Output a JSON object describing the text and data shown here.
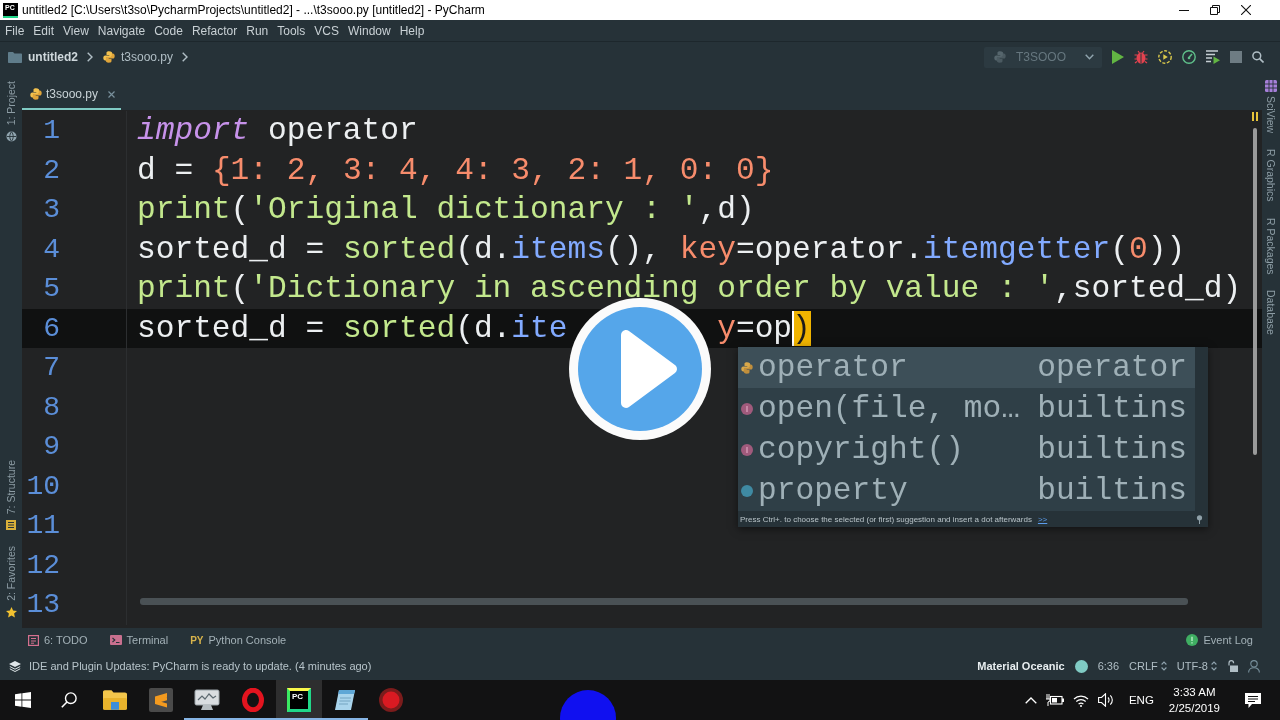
{
  "window": {
    "icon_label": "PC",
    "title": "untitled2 [C:\\Users\\t3so\\PycharmProjects\\untitled2] - ...\\t3sooo.py [untitled2] - PyCharm"
  },
  "menu": [
    "File",
    "Edit",
    "View",
    "Navigate",
    "Code",
    "Refactor",
    "Run",
    "Tools",
    "VCS",
    "Window",
    "Help"
  ],
  "breadcrumbs": [
    {
      "kind": "folder",
      "label": "untitled2"
    },
    {
      "kind": "python_file",
      "label": "t3sooo.py"
    }
  ],
  "run_config": {
    "label": "T3SOOO"
  },
  "left_tools": [
    {
      "kind": "project",
      "label": "1: Project"
    },
    {
      "kind": "structure",
      "label": "7: Structure"
    },
    {
      "kind": "favorites",
      "label": "2: Favorites"
    }
  ],
  "editor_tabs": [
    {
      "label": "t3sooo.py",
      "selected": true
    }
  ],
  "editor": {
    "lines": [
      {
        "number": "1",
        "current": false,
        "tokens": [
          {
            "text": "import",
            "kind": "keyword"
          },
          {
            "text": " operator",
            "kind": "plain"
          }
        ]
      },
      {
        "number": "2",
        "current": false,
        "tokens": [
          {
            "text": "d = ",
            "kind": "plain"
          },
          {
            "text": "{1: 2, 3: 4, 4: 3, 2: 1, 0: 0}",
            "kind": "literal"
          }
        ]
      },
      {
        "number": "3",
        "current": false,
        "tokens": [
          {
            "text": "print",
            "kind": "builtin"
          },
          {
            "text": "(",
            "kind": "plain"
          },
          {
            "text": "'Original dictionary : '",
            "kind": "string"
          },
          {
            "text": ",d)",
            "kind": "plain"
          }
        ]
      },
      {
        "number": "4",
        "current": false,
        "tokens": [
          {
            "text": "sorted_d = ",
            "kind": "plain"
          },
          {
            "text": "sorted",
            "kind": "builtin"
          },
          {
            "text": "(d.",
            "kind": "plain"
          },
          {
            "text": "items",
            "kind": "method"
          },
          {
            "text": "(), ",
            "kind": "plain"
          },
          {
            "text": "key",
            "kind": "param"
          },
          {
            "text": "=operator.",
            "kind": "plain"
          },
          {
            "text": "itemgetter",
            "kind": "method"
          },
          {
            "text": "(",
            "kind": "plain"
          },
          {
            "text": "0",
            "kind": "literal"
          },
          {
            "text": "))",
            "kind": "plain"
          }
        ]
      },
      {
        "number": "5",
        "current": false,
        "tokens": [
          {
            "text": "print",
            "kind": "builtin"
          },
          {
            "text": "(",
            "kind": "plain"
          },
          {
            "text": "'Dictionary in ascending order by value : '",
            "kind": "string"
          },
          {
            "text": ",sorted_d)",
            "kind": "plain"
          }
        ]
      },
      {
        "number": "6",
        "current": true,
        "tokens": [
          {
            "text": "sorted_d = ",
            "kind": "plain"
          },
          {
            "text": "sorted",
            "kind": "builtin"
          },
          {
            "text": "(d.",
            "kind": "plain"
          },
          {
            "text": "ite",
            "kind": "method"
          },
          {
            "kind": "covered"
          },
          {
            "text": "y",
            "kind": "param"
          },
          {
            "text": "=op",
            "kind": "plain"
          },
          {
            "text": ")",
            "kind": "brace_match",
            "caret": true
          }
        ]
      },
      {
        "number": "7",
        "current": false
      },
      {
        "number": "8",
        "current": false
      },
      {
        "number": "9",
        "current": false
      },
      {
        "number": "10",
        "current": false
      },
      {
        "number": "11",
        "current": false
      },
      {
        "number": "12",
        "current": false
      },
      {
        "number": "13",
        "current": false
      }
    ]
  },
  "completion": {
    "items": [
      {
        "kind": "module",
        "label": "operator",
        "source": "operator",
        "selected": true
      },
      {
        "kind": "function",
        "label": "open(file, mo…",
        "source": "builtins",
        "selected": false
      },
      {
        "kind": "function",
        "label": "copyright()",
        "source": "builtins",
        "selected": false
      },
      {
        "kind": "class",
        "label": "property",
        "source": "builtins",
        "selected": false
      }
    ],
    "hint": "Press Ctrl+. to choose the selected (or first) suggestion and insert a dot afterwards",
    "link": ">>"
  },
  "right_tools": [
    {
      "kind": "sciview",
      "label": "SciView"
    },
    {
      "kind": "r_graphics",
      "label": "R Graphics"
    },
    {
      "kind": "r_packages",
      "label": "R Packages"
    },
    {
      "kind": "database",
      "label": "Database"
    }
  ],
  "bottom_tools": [
    {
      "kind": "todo",
      "label": "6: TODO"
    },
    {
      "kind": "terminal",
      "label": "Terminal"
    },
    {
      "kind": "python_console",
      "icon_label": "PY",
      "label": "Python Console"
    }
  ],
  "event_log": {
    "label": "Event Log"
  },
  "status_bar": {
    "message": "IDE and Plugin Updates: PyCharm is ready to update. (4 minutes ago)",
    "theme": "Material Oceanic",
    "position": "6:36",
    "line_separator": "CRLF",
    "encoding": "UTF-8"
  },
  "taskbar": {
    "apps": [
      {
        "kind": "folder",
        "selected": false,
        "running": false
      },
      {
        "kind": "editor",
        "selected": false,
        "running": false
      },
      {
        "kind": "monitor",
        "selected": false,
        "running": true
      },
      {
        "kind": "browser",
        "selected": false,
        "running": true
      },
      {
        "kind": "ide",
        "label": "PC",
        "selected": true,
        "running": true
      },
      {
        "kind": "notepad",
        "selected": false,
        "running": true
      },
      {
        "kind": "recorder",
        "selected": false,
        "running": false
      }
    ],
    "language": "ENG",
    "time": "3:33 AM",
    "date": "2/25/2019"
  }
}
